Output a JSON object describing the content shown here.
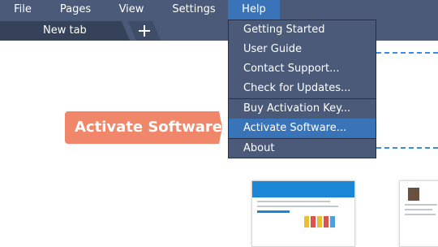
{
  "menubar": {
    "items": [
      "File",
      "Pages",
      "View",
      "Settings",
      "Help"
    ]
  },
  "tabs": {
    "active_label": "New tab",
    "new_tab_icon": "plus-icon"
  },
  "help_menu": {
    "items": [
      "Getting Started",
      "User Guide",
      "Contact Support...",
      "Check for Updates...",
      "Buy Activation Key...",
      "Activate Software...",
      "About"
    ],
    "highlighted": "Activate Software..."
  },
  "callout": {
    "text": "Activate Software"
  },
  "colors": {
    "menubar": "#4a5a78",
    "highlight": "#3a74b8",
    "callout": "#f0866a",
    "dashed_guide": "#3a8ee0"
  }
}
